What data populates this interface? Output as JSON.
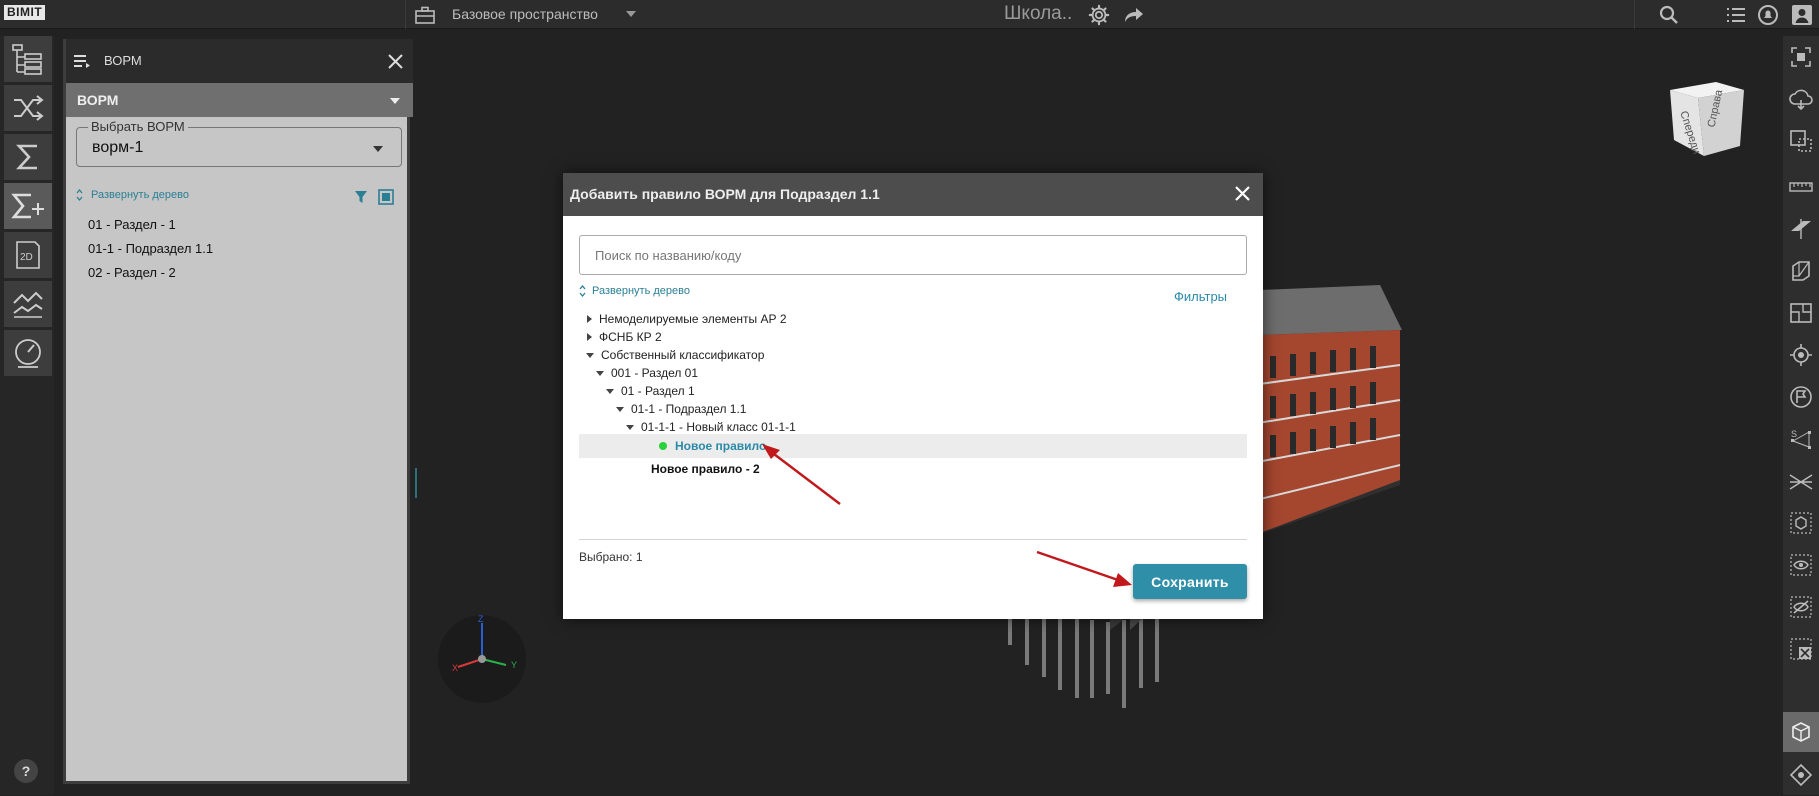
{
  "app": {
    "logo": "BIMIT"
  },
  "topbar": {
    "workspace": "Базовое пространство",
    "project": "Школа.."
  },
  "left_panel": {
    "title": "ВОРМ",
    "section": "ВОРМ",
    "select_label": "Выбрать ВОРМ",
    "select_value": "ворм-1",
    "expand_label": "Развернуть дерево",
    "tree": [
      "01 - Раздел - 1",
      "01-1 - Подраздел 1.1",
      "02 - Раздел - 2"
    ]
  },
  "help": {
    "label": "?"
  },
  "navcube": {
    "front": "Спереди",
    "right": "Справа"
  },
  "axes": {
    "x": "X",
    "y": "Y",
    "z": "Z"
  },
  "modal": {
    "title": "Добавить правило ВОРМ для Подраздел 1.1",
    "search_placeholder": "Поиск по названию/коду",
    "expand_label": "Развернуть дерево",
    "filters_label": "Фильтры",
    "tree": [
      {
        "label": "Немоделируемые элементы АР 2",
        "state": "collapsed",
        "depth": 0
      },
      {
        "label": "ФСНБ КР 2",
        "state": "collapsed",
        "depth": 0
      },
      {
        "label": "Собственный классификатор",
        "state": "expanded",
        "depth": 0
      },
      {
        "label": "001 - Раздел 01",
        "state": "expanded",
        "depth": 1
      },
      {
        "label": "01 - Раздел 1",
        "state": "expanded",
        "depth": 2
      },
      {
        "label": "01-1 - Подраздел 1.1",
        "state": "expanded",
        "depth": 3
      },
      {
        "label": "01-1-1 - Новый класс 01-1-1",
        "state": "expanded",
        "depth": 4
      },
      {
        "label": "Новое правило",
        "state": "selected",
        "depth": 5
      },
      {
        "label": "Новое правило - 2",
        "state": "leaf",
        "depth": 5
      }
    ],
    "selected_count": "Выбрано: 1",
    "save_label": "Сохранить"
  },
  "colors": {
    "accent": "#2f8fa8",
    "selected_dot": "#28d23a",
    "annotation_arrow": "#c0181b"
  }
}
